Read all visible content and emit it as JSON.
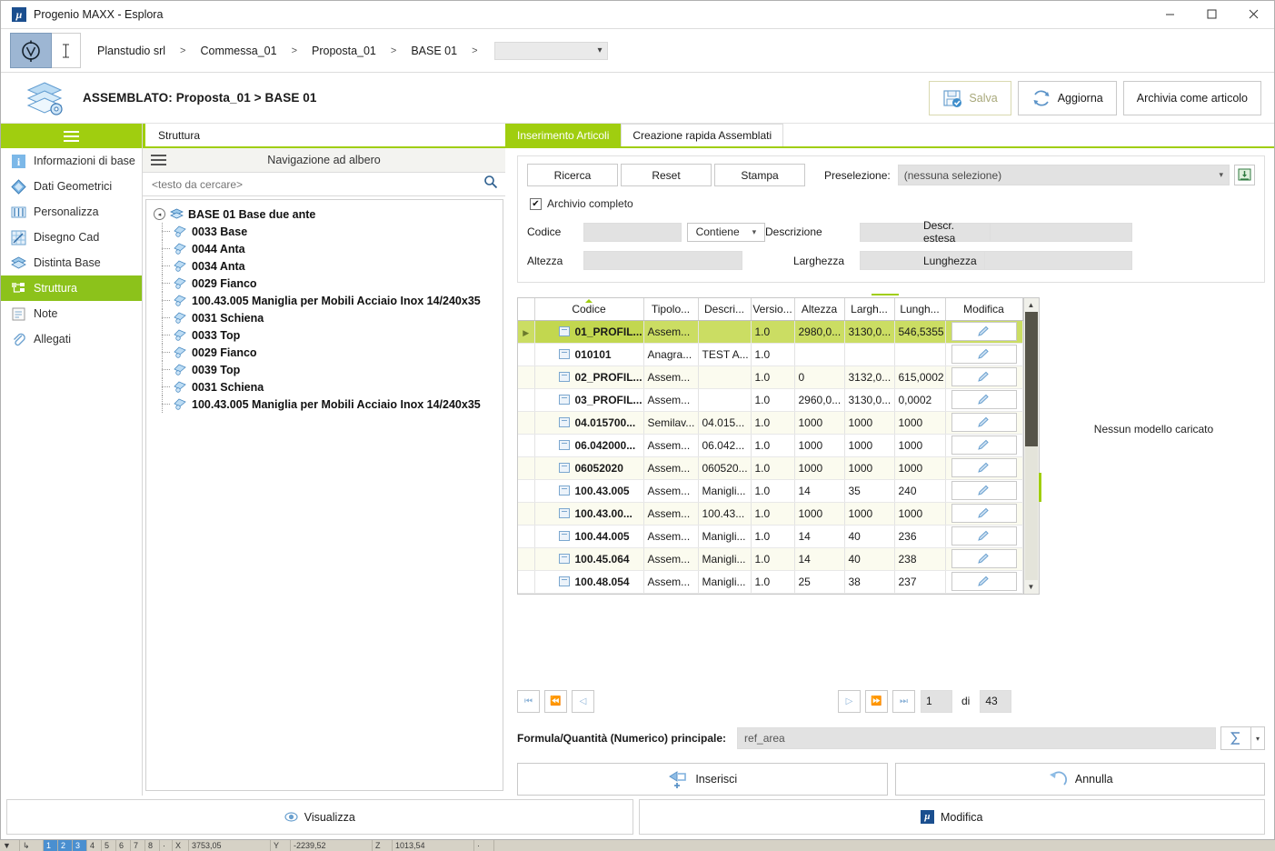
{
  "window": {
    "title": "Progenio MAXX - Esplora",
    "logo_text": "μ",
    "minimize": "–",
    "maximize": "☐",
    "close": "✕"
  },
  "breadcrumb": {
    "items": [
      "Planstudio srl",
      "Commessa_01",
      "Proposta_01",
      "BASE 01"
    ],
    "separator": ">",
    "select_value": "",
    "select_caret": "▾",
    "compass_icon": "compass-icon",
    "caret_icon": "text-cursor-icon"
  },
  "assembly": {
    "title": "ASSEMBLATO: Proposta_01 > BASE 01",
    "buttons": [
      {
        "label": "Salva",
        "icon": "save-icon",
        "state": "disabled"
      },
      {
        "label": "Aggiorna",
        "icon": "refresh-icon",
        "state": "enabled"
      },
      {
        "label": "Archivia come articolo",
        "icon": "none",
        "state": "enabled"
      }
    ]
  },
  "sidebar": {
    "burger_icon": "hamburger-icon",
    "items": [
      {
        "label": "Informazioni di base",
        "icon": "info-icon",
        "active": false
      },
      {
        "label": "Dati Geometrici",
        "icon": "diamond-icon",
        "active": false
      },
      {
        "label": "Personalizza",
        "icon": "sliders-icon",
        "active": false
      },
      {
        "label": "Disegno Cad",
        "icon": "cad-grid-icon",
        "active": false
      },
      {
        "label": "Distinta Base",
        "icon": "layers-icon",
        "active": false
      },
      {
        "label": "Struttura",
        "icon": "structure-icon",
        "active": true
      },
      {
        "label": "Note",
        "icon": "note-icon",
        "active": false
      },
      {
        "label": "Allegati",
        "icon": "paperclip-icon",
        "active": false
      }
    ]
  },
  "tree_panel": {
    "tab_label": "Struttura",
    "header_title": "Navigazione ad albero",
    "search_placeholder": "<testo da cercare>",
    "search_icon": "search-icon",
    "root": {
      "label": "BASE 01 Base due ante",
      "icon": "assembly-icon",
      "expanded": true,
      "expander": "◂"
    },
    "children": [
      {
        "label": "0033 Base",
        "icon": "part-icon"
      },
      {
        "label": "0044 Anta",
        "icon": "part-icon"
      },
      {
        "label": "0034 Anta",
        "icon": "part-icon"
      },
      {
        "label": "0029 Fianco",
        "icon": "part-icon"
      },
      {
        "label": "100.43.005 Maniglia per Mobili Acciaio Inox 14/240x35",
        "icon": "part-icon"
      },
      {
        "label": "0031 Schiena",
        "icon": "part-icon"
      },
      {
        "label": "0033 Top",
        "icon": "part-icon"
      },
      {
        "label": "0029 Fianco",
        "icon": "part-icon"
      },
      {
        "label": "0039 Top",
        "icon": "part-icon"
      },
      {
        "label": "0031 Schiena",
        "icon": "part-icon"
      },
      {
        "label": "100.43.005 Maniglia per Mobili Acciaio Inox 14/240x35",
        "icon": "part-icon"
      }
    ]
  },
  "main": {
    "tabs": [
      {
        "label": "Inserimento Articoli",
        "active": true
      },
      {
        "label": "Creazione rapida Assemblati",
        "active": false
      }
    ],
    "search": {
      "buttons": [
        "Ricerca",
        "Reset",
        "Stampa"
      ],
      "preselezione_label": "Preselezione:",
      "preselezione_value": "(nessuna selezione)",
      "preselezione_caret": "▾",
      "preselezione_go_icon": "import-icon",
      "archivio_checkbox_label": "Archivio completo",
      "archivio_checked": true,
      "check_glyph": "✔",
      "fields": {
        "codice_label": "Codice",
        "codice_value": "",
        "codice_operator": "Contiene",
        "codice_operator_caret": "▾",
        "descrizione_label": "Descrizione",
        "descrizione_value": "",
        "descr_estesa_label": "Descr. estesa",
        "descr_estesa_value": "",
        "altezza_label": "Altezza",
        "altezza_value": "",
        "larghezza_label": "Larghezza",
        "larghezza_value": "",
        "lunghezza_label": "Lunghezza",
        "lunghezza_value": ""
      }
    },
    "grid": {
      "columns": [
        "Codice",
        "Tipolo...",
        "Descri...",
        "Versio...",
        "Altezza",
        "Largh...",
        "Lungh...",
        "Modifica"
      ],
      "sorted_column": "Codice",
      "edit_icon": "pencil-icon",
      "row_icon": "document-icon",
      "selected_index": 0,
      "rows": [
        {
          "codice": "01_PROFIL...",
          "tipologia": "Assem...",
          "descrizione": "",
          "versione": "1.0",
          "altezza": "2980,0...",
          "larghezza": "3130,0...",
          "lunghezza": "546,5355"
        },
        {
          "codice": "010101",
          "tipologia": "Anagra...",
          "descrizione": "TEST A...",
          "versione": "1.0",
          "altezza": "",
          "larghezza": "",
          "lunghezza": ""
        },
        {
          "codice": "02_PROFIL...",
          "tipologia": "Assem...",
          "descrizione": "",
          "versione": "1.0",
          "altezza": "0",
          "larghezza": "3132,0...",
          "lunghezza": "615,0002"
        },
        {
          "codice": "03_PROFIL...",
          "tipologia": "Assem...",
          "descrizione": "",
          "versione": "1.0",
          "altezza": "2960,0...",
          "larghezza": "3130,0...",
          "lunghezza": "0,0002"
        },
        {
          "codice": "04.015700...",
          "tipologia": "Semilav...",
          "descrizione": "04.015...",
          "versione": "1.0",
          "altezza": "1000",
          "larghezza": "1000",
          "lunghezza": "1000"
        },
        {
          "codice": "06.042000...",
          "tipologia": "Assem...",
          "descrizione": "06.042...",
          "versione": "1.0",
          "altezza": "1000",
          "larghezza": "1000",
          "lunghezza": "1000"
        },
        {
          "codice": "06052020",
          "tipologia": "Assem...",
          "descrizione": "060520...",
          "versione": "1.0",
          "altezza": "1000",
          "larghezza": "1000",
          "lunghezza": "1000"
        },
        {
          "codice": "100.43.005",
          "tipologia": "Assem...",
          "descrizione": "Manigli...",
          "versione": "1.0",
          "altezza": "14",
          "larghezza": "35",
          "lunghezza": "240"
        },
        {
          "codice": "100.43.00...",
          "tipologia": "Assem...",
          "descrizione": "100.43...",
          "versione": "1.0",
          "altezza": "1000",
          "larghezza": "1000",
          "lunghezza": "1000"
        },
        {
          "codice": "100.44.005",
          "tipologia": "Assem...",
          "descrizione": "Manigli...",
          "versione": "1.0",
          "altezza": "14",
          "larghezza": "40",
          "lunghezza": "236"
        },
        {
          "codice": "100.45.064",
          "tipologia": "Assem...",
          "descrizione": "Manigli...",
          "versione": "1.0",
          "altezza": "14",
          "larghezza": "40",
          "lunghezza": "238"
        },
        {
          "codice": "100.48.054",
          "tipologia": "Assem...",
          "descrizione": "Manigli...",
          "versione": "1.0",
          "altezza": "25",
          "larghezza": "38",
          "lunghezza": "237"
        }
      ]
    },
    "preview": {
      "empty_text": "Nessun modello caricato"
    },
    "pager": {
      "first": "⏮",
      "prev_fast": "⏪",
      "prev": "◁",
      "next": "▷",
      "next_fast": "⏩",
      "last": "⏭",
      "current_page": "1",
      "di_label": "di",
      "total_pages": "43"
    },
    "formula": {
      "label": "Formula/Quantità  (Numerico) principale:",
      "value": "ref_area",
      "sum_icon": "sigma-icon",
      "caret": "▾"
    },
    "actions": [
      {
        "label": "Inserisci",
        "icon": "insert-arrow-icon"
      },
      {
        "label": "Annulla",
        "icon": "undo-arrow-icon"
      }
    ]
  },
  "footer": {
    "buttons": [
      {
        "label": "Visualizza",
        "icon": "eye-icon"
      },
      {
        "label": "Modifica",
        "icon": "mu-logo-icon"
      }
    ]
  },
  "background_strip": {
    "cells": [
      "▼",
      "↳",
      "1",
      "2",
      "3",
      "4",
      "5",
      "6",
      "7",
      "8",
      "·",
      "X",
      "3753,05",
      "Y",
      "-2239,52",
      "Z",
      "1013,54",
      "·"
    ]
  }
}
